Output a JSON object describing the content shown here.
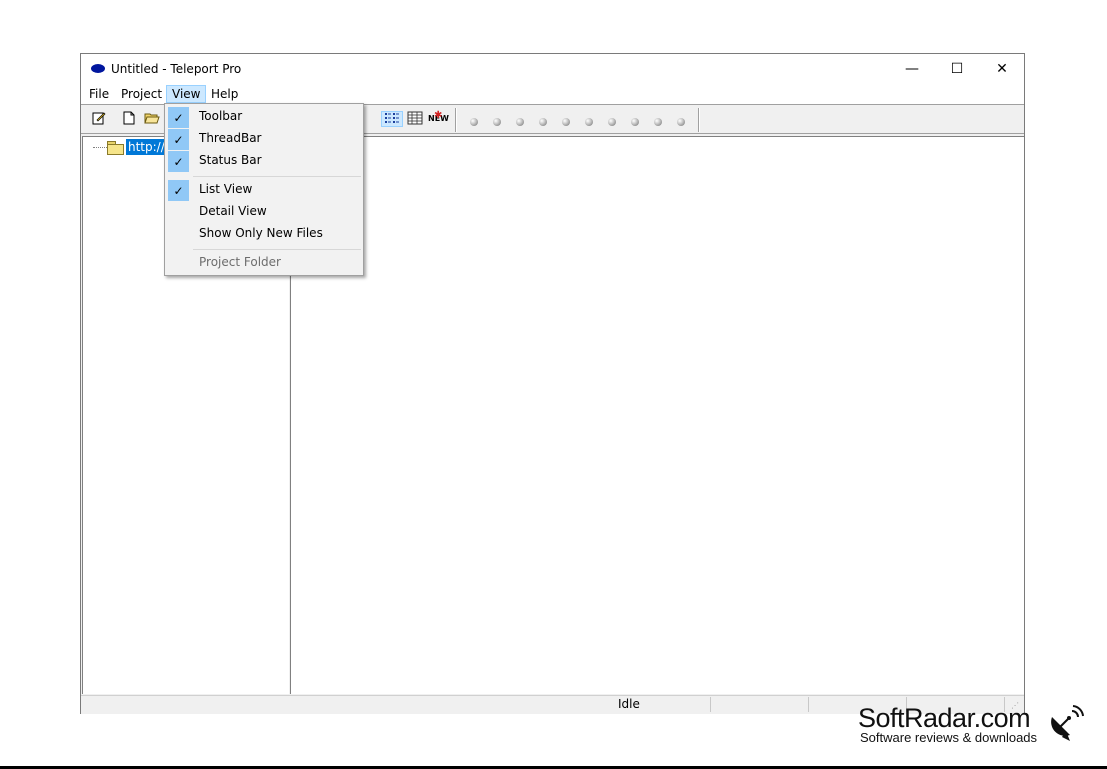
{
  "window": {
    "title": "Untitled - Teleport Pro",
    "controls": {
      "minimize": "—",
      "maximize": "☐",
      "close": "✕"
    }
  },
  "menubar": {
    "items": [
      {
        "label": "File"
      },
      {
        "label": "Project"
      },
      {
        "label": "View",
        "active": true
      },
      {
        "label": "Help"
      }
    ]
  },
  "toolbar": {
    "buttons": [
      "edit-icon",
      "new-icon",
      "open-icon",
      "list-view-icon",
      "detail-view-icon",
      "new-files-icon"
    ],
    "new_badge": "NEW",
    "thread_indicators": 10
  },
  "tree": {
    "root_label": "http://3"
  },
  "view_menu": {
    "items": [
      {
        "label": "Toolbar",
        "checked": true
      },
      {
        "label": "ThreadBar",
        "checked": true
      },
      {
        "label": "Status Bar",
        "checked": true
      },
      {
        "label": "List View",
        "checked": true
      },
      {
        "label": "Detail View",
        "checked": false
      },
      {
        "label": "Show Only New Files",
        "checked": false
      },
      {
        "label": "Project Folder",
        "checked": false,
        "disabled": true
      }
    ]
  },
  "statusbar": {
    "text": "Idle"
  },
  "watermark": {
    "title": "SoftRadar.com",
    "subtitle": "Software reviews & downloads"
  }
}
